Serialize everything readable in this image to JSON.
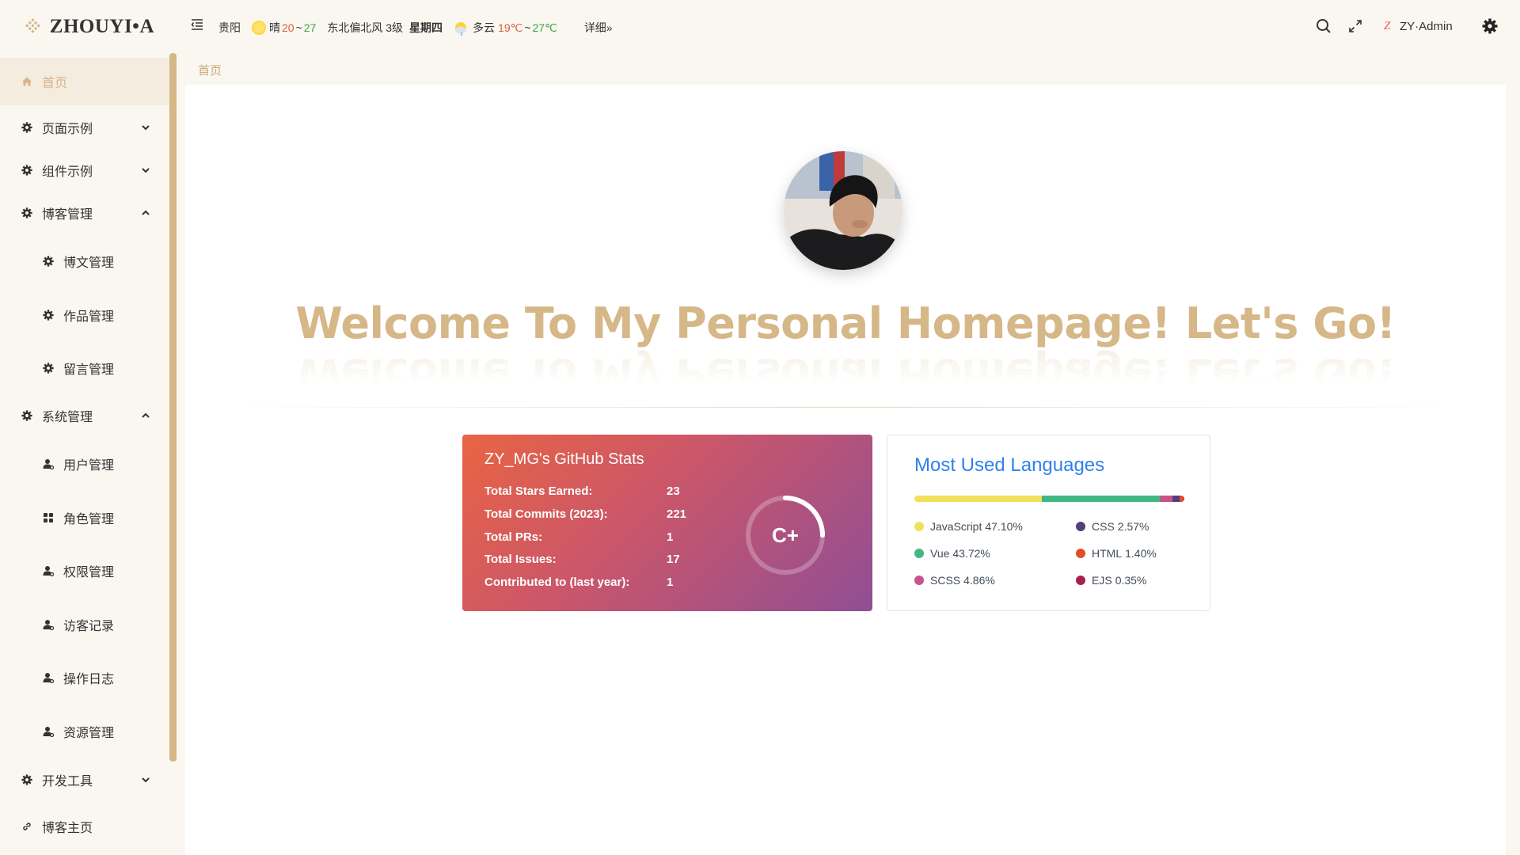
{
  "header": {
    "logo_text": "ZHOUYI•A",
    "weather": {
      "city": "贵阳",
      "today_cond": "晴",
      "today_high": "20",
      "temp_sep": "~",
      "today_low": "27",
      "wind": "东北偏北风 3级",
      "weekday": "星期四",
      "tomorrow_cond": "多云",
      "tomorrow_range_low": "19℃",
      "tomorrow_range_high": "27℃",
      "detail": "详细»"
    },
    "user_initial": "Z",
    "user_name": "ZY·Admin"
  },
  "sidebar": {
    "items": [
      {
        "label": "首页",
        "icon": "home-icon"
      },
      {
        "label": "页面示例",
        "icon": "gear-icon"
      },
      {
        "label": "组件示例",
        "icon": "gear-icon"
      },
      {
        "label": "博客管理",
        "icon": "gear-icon"
      },
      {
        "label": "博文管理",
        "icon": "gear-icon"
      },
      {
        "label": "作品管理",
        "icon": "gear-icon"
      },
      {
        "label": "留言管理",
        "icon": "gear-icon"
      },
      {
        "label": "系统管理",
        "icon": "gear-icon"
      },
      {
        "label": "用户管理",
        "icon": "user-icon"
      },
      {
        "label": "角色管理",
        "icon": "grid-icon"
      },
      {
        "label": "权限管理",
        "icon": "user-icon"
      },
      {
        "label": "访客记录",
        "icon": "user-icon"
      },
      {
        "label": "操作日志",
        "icon": "user-icon"
      },
      {
        "label": "资源管理",
        "icon": "user-icon"
      },
      {
        "label": "开发工具",
        "icon": "gear-icon"
      },
      {
        "label": "博客主页",
        "icon": "link-icon"
      }
    ]
  },
  "tabs": [
    {
      "label": "首页"
    }
  ],
  "main": {
    "welcome": "Welcome To My Personal Homepage! Let's Go!",
    "github_stats": {
      "title": "ZY_MG's GitHub Stats",
      "rows": [
        {
          "label": "Total Stars Earned:",
          "value": "23"
        },
        {
          "label": "Total Commits (2023):",
          "value": "221"
        },
        {
          "label": "Total PRs:",
          "value": "1"
        },
        {
          "label": "Total Issues:",
          "value": "17"
        },
        {
          "label": "Contributed to (last year):",
          "value": "1"
        }
      ],
      "rank": "C+",
      "rank_progress": 0.25
    },
    "languages": {
      "title": "Most Used Languages",
      "items": [
        {
          "name": "JavaScript",
          "pct": "47.10%",
          "value": 47.1,
          "color": "#f1e05a"
        },
        {
          "name": "Vue",
          "pct": "43.72%",
          "value": 43.72,
          "color": "#41b883"
        },
        {
          "name": "SCSS",
          "pct": "4.86%",
          "value": 4.86,
          "color": "#c6538c"
        },
        {
          "name": "CSS",
          "pct": "2.57%",
          "value": 2.57,
          "color": "#563d7c"
        },
        {
          "name": "HTML",
          "pct": "1.40%",
          "value": 1.4,
          "color": "#e34c26"
        },
        {
          "name": "EJS",
          "pct": "0.35%",
          "value": 0.35,
          "color": "#a91e50"
        }
      ]
    }
  },
  "colors": {
    "accent": "#d6b788",
    "sidebar_bg": "#faf7f1",
    "active_text": "#d9b58a"
  }
}
